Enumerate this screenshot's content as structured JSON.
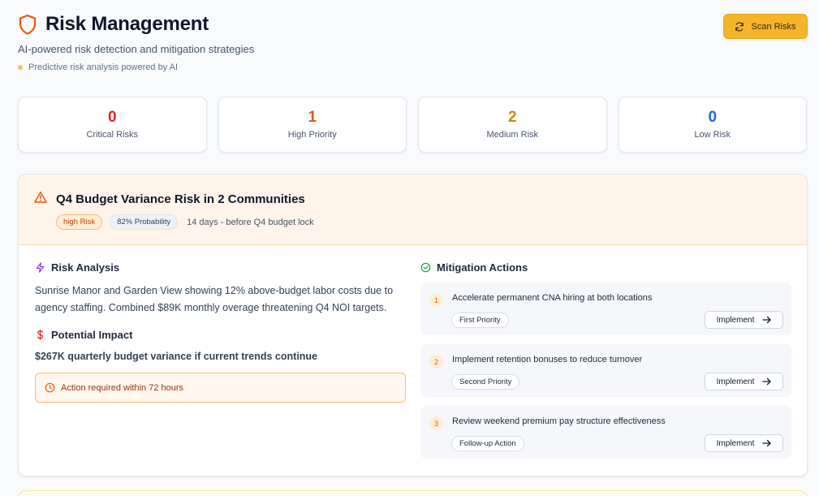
{
  "header": {
    "title": "Risk Management",
    "subtitle": "AI-powered risk detection and mitigation strategies",
    "hint": "Predictive risk analysis powered by AI",
    "scan_label": "Scan Risks"
  },
  "stats": [
    {
      "value": "0",
      "label": "Critical Risks",
      "color": "#dc2626"
    },
    {
      "value": "1",
      "label": "High Priority",
      "color": "#ea580c"
    },
    {
      "value": "2",
      "label": "Medium Risk",
      "color": "#ca8a04"
    },
    {
      "value": "0",
      "label": "Low Risk",
      "color": "#2563eb"
    }
  ],
  "risk": {
    "title": "Q4 Budget Variance Risk in 2 Communities",
    "level": "high Risk",
    "probability": "82% Probability",
    "timeline": "14 days - before Q4 budget lock",
    "analysis_heading": "Risk Analysis",
    "analysis_text": "Sunrise Manor and Garden View showing 12% above-budget labor costs due to agency staffing. Combined $89K monthly overage threatening Q4 NOI targets.",
    "impact_heading": "Potential Impact",
    "impact_text": "$267K quarterly budget variance if current trends continue",
    "action_required": "Action required within 72 hours",
    "mitigation_heading": "Mitigation Actions",
    "actions": [
      {
        "num": "1",
        "text": "Accelerate permanent CNA hiring at both locations",
        "tag": "First Priority",
        "button": "Implement"
      },
      {
        "num": "2",
        "text": "Implement retention bonuses to reduce turnover",
        "tag": "Second Priority",
        "button": "Implement"
      },
      {
        "num": "3",
        "text": "Review weekend premium pay structure effectiveness",
        "tag": "Follow-up Action",
        "button": "Implement"
      }
    ]
  },
  "icons": {
    "title": "shield-icon",
    "scan": "refresh-icon",
    "warning": "alert-triangle-icon",
    "analysis": "lightning-icon",
    "impact": "dollar-icon",
    "action": "clock-icon",
    "mitigation": "check-circle-icon",
    "implement": "arrow-right-icon"
  },
  "colors": {
    "accent": "#ea580c",
    "scan_button": "#f5b52b",
    "card_header": "#fff4ea"
  }
}
